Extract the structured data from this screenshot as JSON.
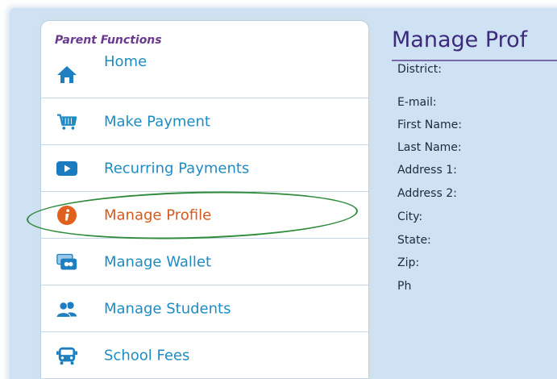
{
  "sidebar": {
    "section_title": "Parent Functions",
    "items": [
      {
        "label": "Home",
        "icon": "home-icon"
      },
      {
        "label": "Make Payment",
        "icon": "cart-icon"
      },
      {
        "label": "Recurring Payments",
        "icon": "play-icon"
      },
      {
        "label": "Manage Profile",
        "icon": "info-icon",
        "active": true
      },
      {
        "label": "Manage Wallet",
        "icon": "wallet-icon"
      },
      {
        "label": "Manage Students",
        "icon": "students-icon"
      },
      {
        "label": "School Fees",
        "icon": "bus-icon"
      }
    ]
  },
  "main": {
    "title": "Manage Prof",
    "fields": [
      "District:",
      "E-mail:",
      "First Name:",
      "Last Name:",
      "Address 1:",
      "Address 2:",
      "City:",
      "State:",
      "Zip:",
      "Ph"
    ]
  },
  "colors": {
    "link": "#1e8cc4",
    "active": "#d65a1c",
    "title": "#3c2a7a",
    "section": "#6b3a8f",
    "highlight": "#2e8b3a",
    "background": "#cfe2f3"
  }
}
